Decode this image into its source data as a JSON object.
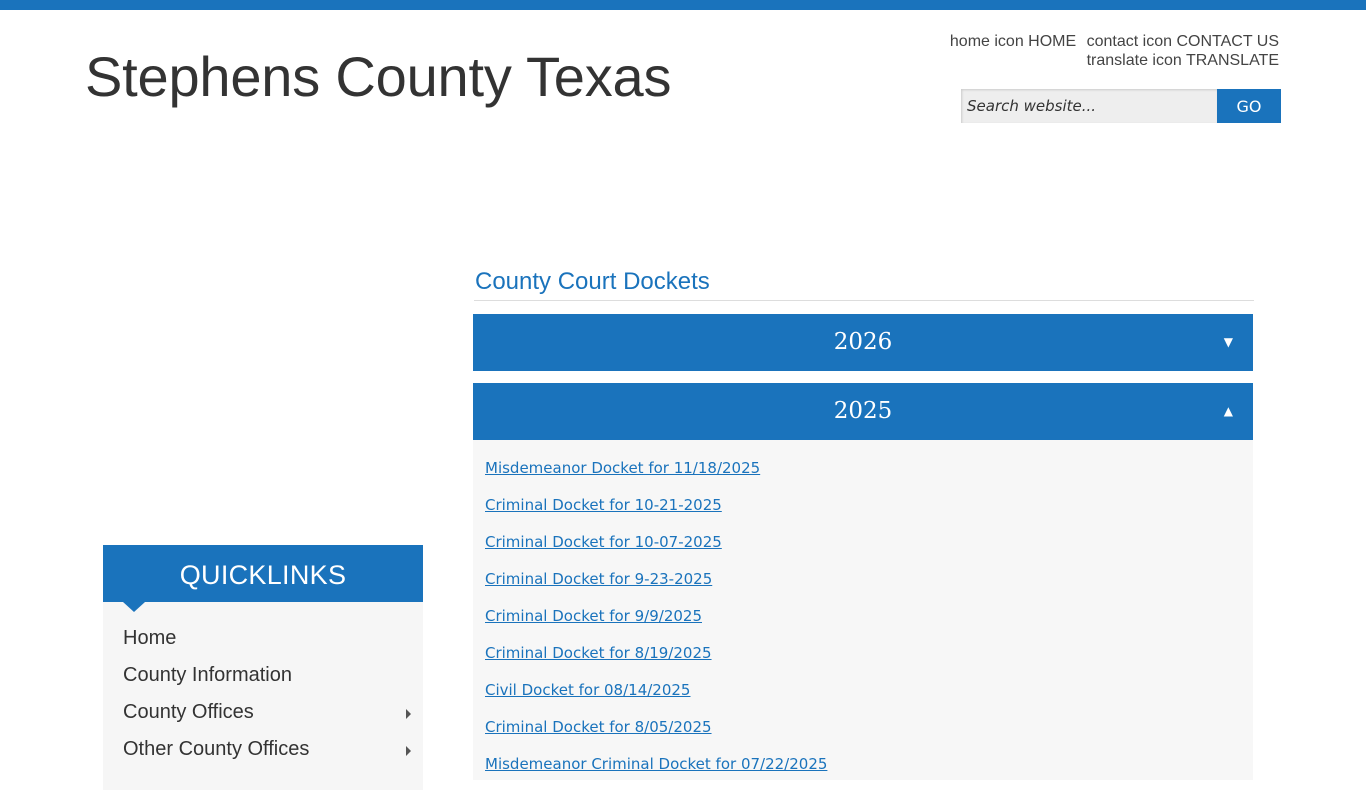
{
  "colors": {
    "brand_blue": "#1a73bc",
    "panel_bg": "#f6f6f6",
    "text": "#333333"
  },
  "header": {
    "site_title": "Stephens County Texas",
    "util": {
      "home_icon_alt": "home icon",
      "home_label": "HOME",
      "contact_icon_alt": "contact icon",
      "contact_label": "CONTACT US",
      "translate_icon_alt": "translate icon",
      "translate_label": "TRANSLATE"
    },
    "search": {
      "placeholder": "Search website...",
      "button_label": "GO"
    }
  },
  "sidebar": {
    "title": "QUICKLINKS",
    "items": [
      {
        "label": "Home",
        "has_submenu": false
      },
      {
        "label": "County Information",
        "has_submenu": false
      },
      {
        "label": "County Offices",
        "has_submenu": true
      },
      {
        "label": "Other County Offices",
        "has_submenu": true
      }
    ]
  },
  "main": {
    "heading": "County Court Dockets",
    "accordions": [
      {
        "year": "2026",
        "caret": "▼",
        "expanded": false
      },
      {
        "year": "2025",
        "caret": "▲",
        "expanded": true
      }
    ],
    "dockets_2025": [
      "Misdemeanor Docket for 11/18/2025",
      "Criminal Docket for 10-21-2025",
      "Criminal Docket for 10-07-2025",
      "Criminal Docket for 9-23-2025",
      "Criminal Docket for 9/9/2025",
      "Criminal Docket for 8/19/2025",
      "Civil Docket for 08/14/2025",
      "Criminal Docket for 8/05/2025",
      "Misdemeanor Criminal Docket for 07/22/2025"
    ]
  }
}
